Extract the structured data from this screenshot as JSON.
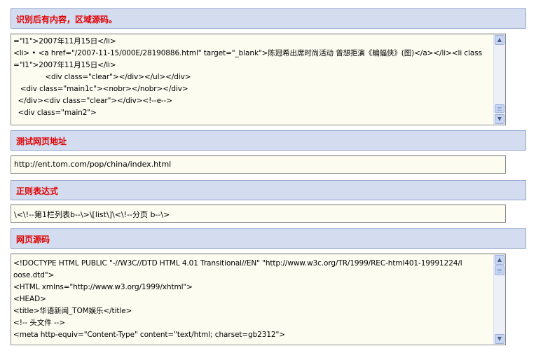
{
  "sections": {
    "result": {
      "title": "识别后有内容，区域源码。",
      "lines": [
        "=\"l1\">2007年11月15日</li>",
        "<li> • <a href=\"/2007-11-15/000E/28190886.html\" target=\"_blank\">陈冠希出席时尚活动 曾想拒演《蝙蝠侠》(图)</a></li><li class",
        "=\"l1\">2007年11月15日</li>",
        "              <div class=\"clear\"></div></ul></div>",
        "   <div class=\"main1c\"><nobr></nobr></div>",
        "  </div><div class=\"clear\"></div><!--e-->",
        "  <div class=\"main2\">"
      ]
    },
    "url": {
      "title": "测试网页地址",
      "value": "http://ent.tom.com/pop/china/index.html"
    },
    "regex": {
      "title": "正则表达式",
      "value": "\\<\\!--第1栏列表b--\\>\\[list\\]\\<\\!--分页  b--\\>"
    },
    "source": {
      "title": "网页源码",
      "lines": [
        "<!DOCTYPE HTML PUBLIC \"-//W3C//DTD HTML 4.01 Transitional//EN\" \"http://www.w3c.org/TR/1999/REC-html401-19991224/l",
        "oose.dtd\">",
        "<HTML xmlns=\"http://www.w3.org/1999/xhtml\">",
        "<HEAD>",
        "<title>华语新闻_TOM娱乐</title>",
        "<!-- 头文件 -->",
        "<meta http-equiv=\"Content-Type\" content=\"text/html; charset=gb2312\">"
      ]
    }
  },
  "scrollbar": {
    "up_arrow_icon": "chevron-up-icon",
    "down_arrow_icon": "chevron-down-icon",
    "result_scroll_position": 0.85,
    "source_scroll_position": 0.0
  },
  "colors": {
    "header_bg": "#d4dcf0",
    "header_border": "#93a5cf",
    "header_text": "#e00000",
    "field_bg": "#fcfcf0"
  }
}
